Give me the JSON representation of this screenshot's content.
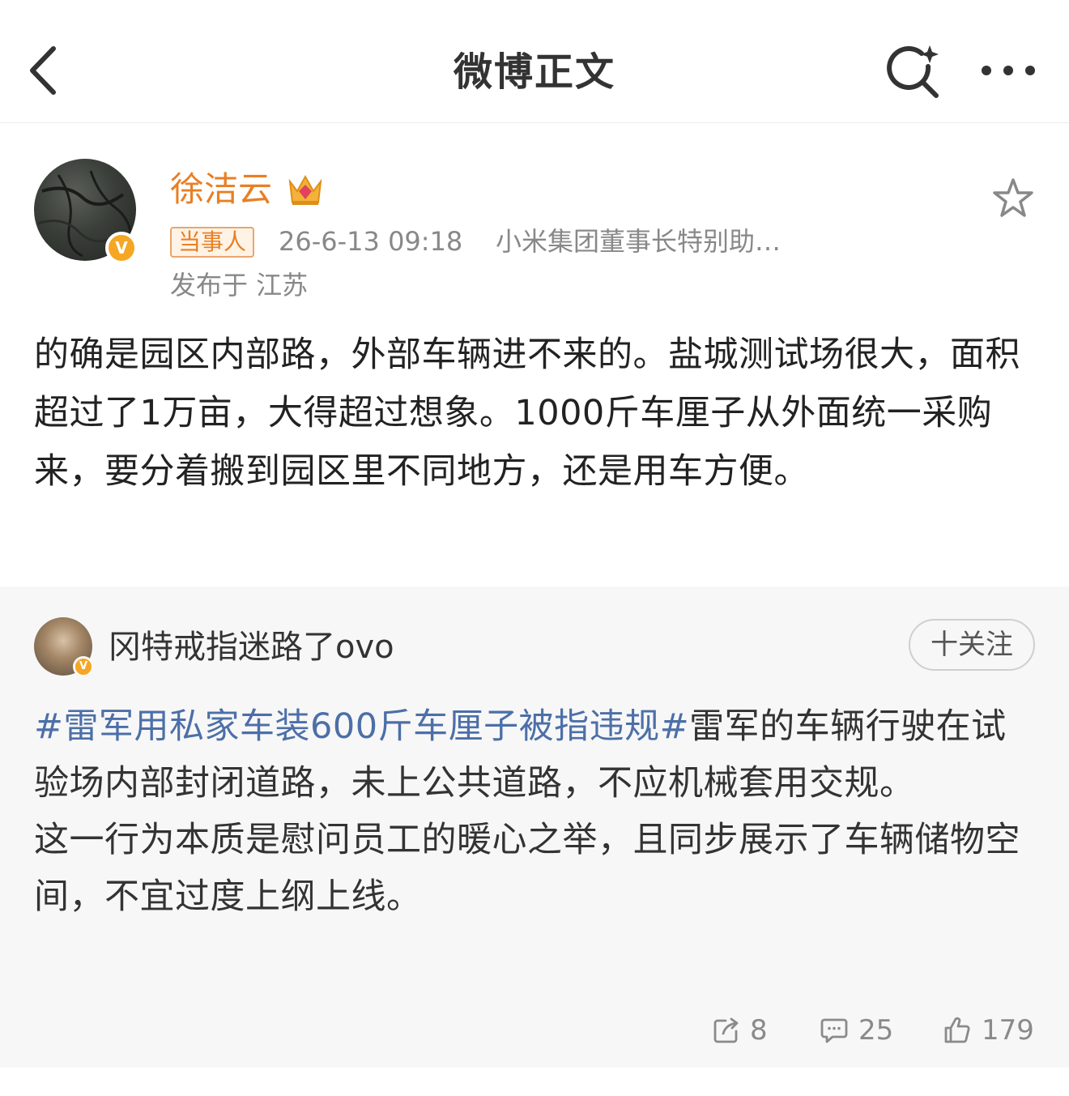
{
  "header": {
    "title": "微博正文"
  },
  "post": {
    "author_name": "徐洁云",
    "role_tag": "当事人",
    "timestamp": "26-6-13 09:18",
    "source": "小米集团董事长特别助…",
    "location": "发布于 江苏",
    "text": "的确是园区内部路，外部车辆进不来的。盐城测试场很大，面积超过了1万亩，大得超过想象。1000斤车厘子从外面统一采购来，要分着搬到园区里不同地方，还是用车方便。"
  },
  "repost": {
    "author_name": "冈特戒指迷路了ovo",
    "follow_label": "十关注",
    "topic": "#雷军用私家车装600斤车厘子被指违规#",
    "text_line1": "雷军的车辆行驶在试验场内部封闭道路，未上公共道路，不应机械套用交规。",
    "text_line2": "这一行为本质是慰问员工的暖心之举，且同步展示了车辆储物空间，不宜过度上纲上线。"
  },
  "actions": {
    "repost_count": "8",
    "comment_count": "25",
    "like_count": "179"
  },
  "colors": {
    "author_name": "#e87f24",
    "topic_link": "#4c6fa8",
    "verified_badge": "#f5a623",
    "repost_bg": "#f7f7f7"
  },
  "icons": [
    "back-arrow-icon",
    "search-sparkle-icon",
    "more-dots-icon",
    "crown-icon",
    "verified-v-icon",
    "star-icon",
    "repost-icon",
    "comment-icon",
    "like-icon"
  ]
}
